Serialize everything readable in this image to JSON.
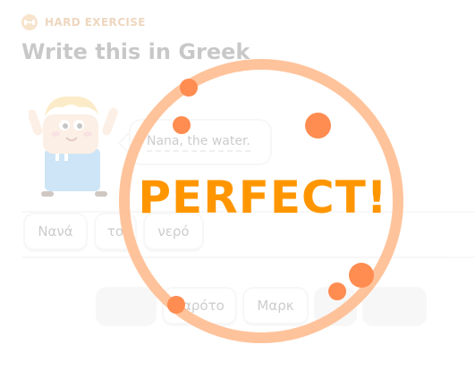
{
  "header": {
    "badge_label": "HARD EXERCISE",
    "badge_icon": "dumbbell-icon",
    "title": "Write this in Greek"
  },
  "prompt": {
    "text": "Nana, the water."
  },
  "answer_tiles": [
    "Νανά",
    "το",
    "νερό"
  ],
  "word_bank": [
    "",
    "καρότο",
    "Μαρκ",
    "",
    ""
  ],
  "overlay": {
    "message": "PERFECT!",
    "colors": {
      "text": "#ff9600",
      "ring": "#ffb98a",
      "dots": "#ff8c50"
    }
  }
}
